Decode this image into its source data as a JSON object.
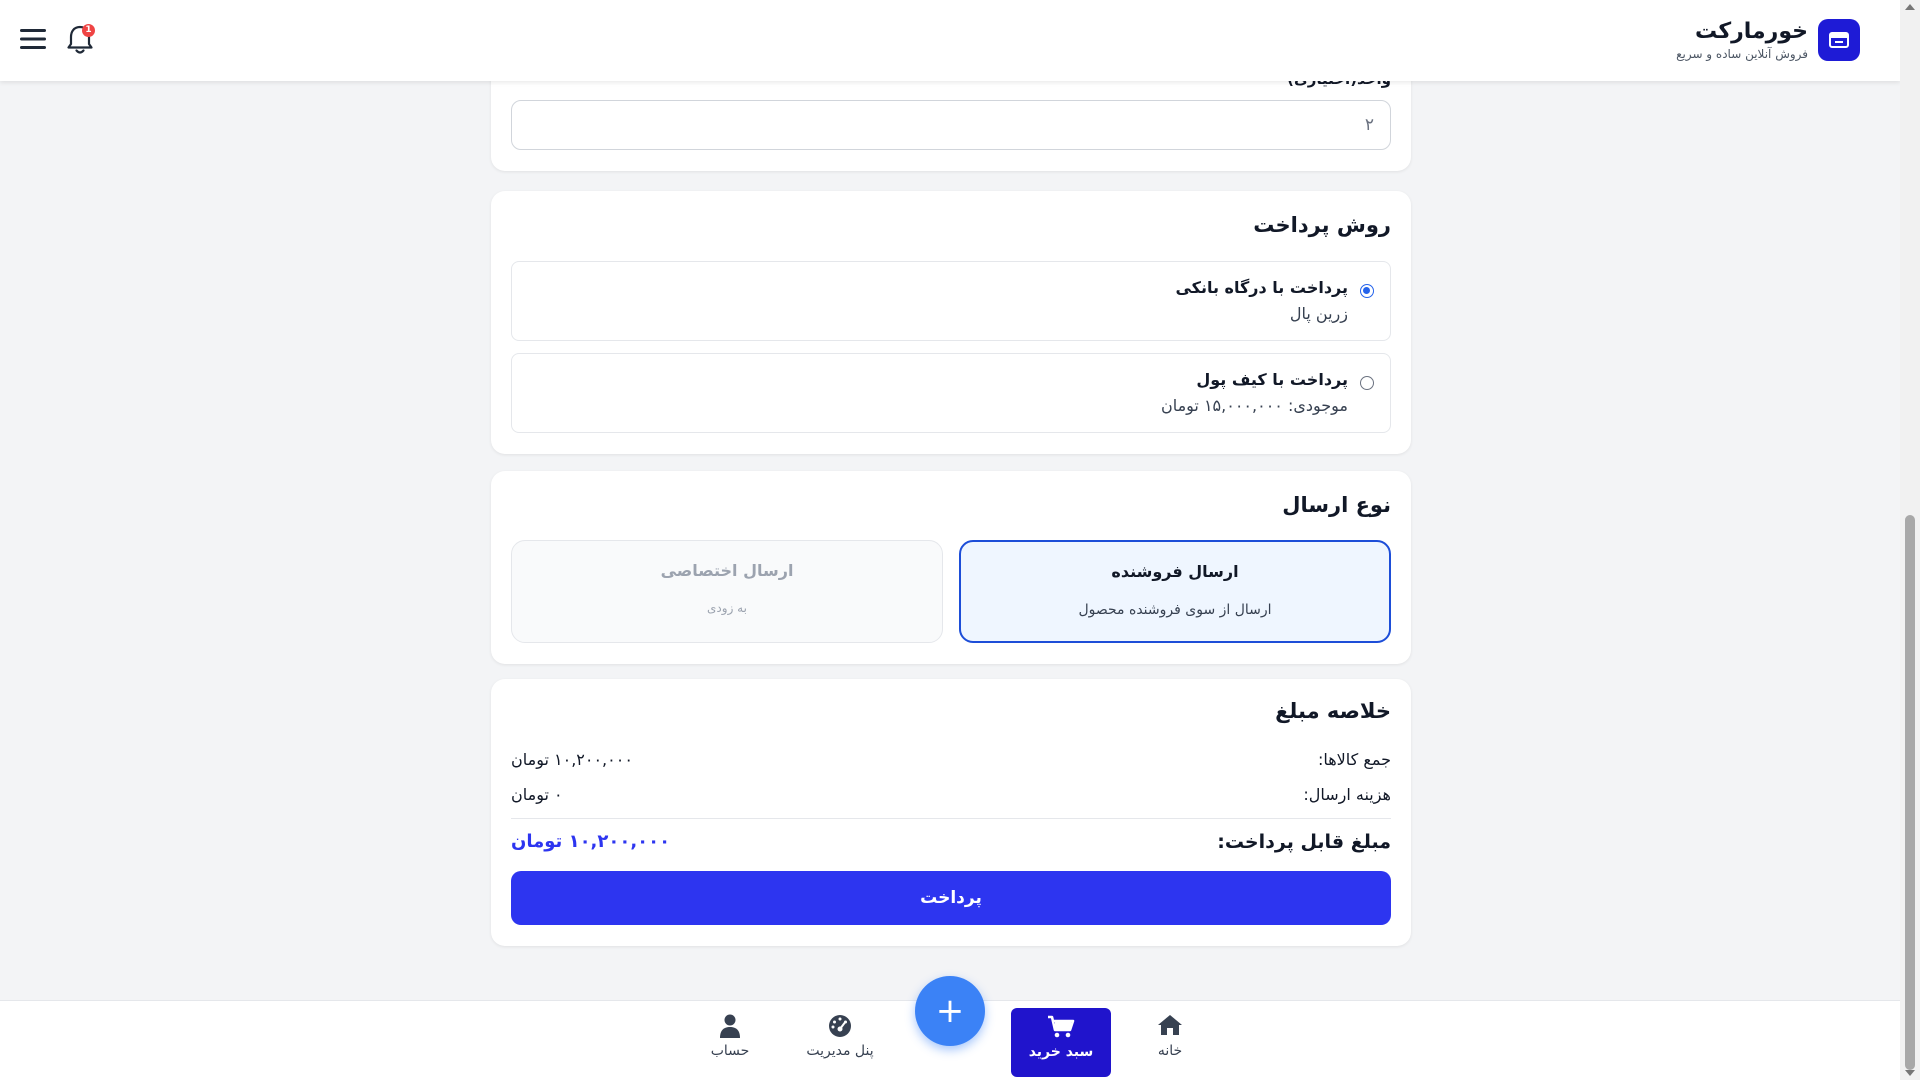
{
  "header": {
    "brand_name": "خورمارکت",
    "brand_tagline": "فروش آنلاین ساده و سریع",
    "notification_count": "1"
  },
  "unit_section": {
    "label": "واحد(اختیاری)",
    "input_value": "۲"
  },
  "payment": {
    "title": "روش پرداخت",
    "options": [
      {
        "title": "پرداخت با درگاه بانکی",
        "subtitle": "زرین پال",
        "selected": true
      },
      {
        "title": "پرداخت با کیف پول",
        "subtitle": "موجودی: ۱۵,۰۰۰,۰۰۰ تومان",
        "selected": false
      }
    ]
  },
  "shipping": {
    "title": "نوع ارسال",
    "options": [
      {
        "title": "ارسال فروشنده",
        "subtitle": "ارسال از سوی فروشنده محصول",
        "active": true
      },
      {
        "title": "ارسال اختصاصی",
        "subtitle": "به زودی",
        "active": false
      }
    ]
  },
  "summary": {
    "title": "خلاصه مبلغ",
    "items_total_label": "جمع کالاها:",
    "items_total_value": "۱۰,۲۰۰,۰۰۰ تومان",
    "shipping_cost_label": "هزینه ارسال:",
    "shipping_cost_value": "۰ تومان",
    "payable_label": "مبلغ قابل پرداخت:",
    "payable_value": "۱۰,۲۰۰,۰۰۰ تومان",
    "pay_button": "پرداخت"
  },
  "bottom_nav": {
    "home": "خانه",
    "cart": "سبد خرید",
    "admin": "پنل مدیریت",
    "account": "حساب",
    "fab": "+"
  },
  "colors": {
    "primary": "#2d35f0",
    "brand": "#1e1bd6",
    "fab": "#3b82f6",
    "badge": "#ef4444"
  }
}
